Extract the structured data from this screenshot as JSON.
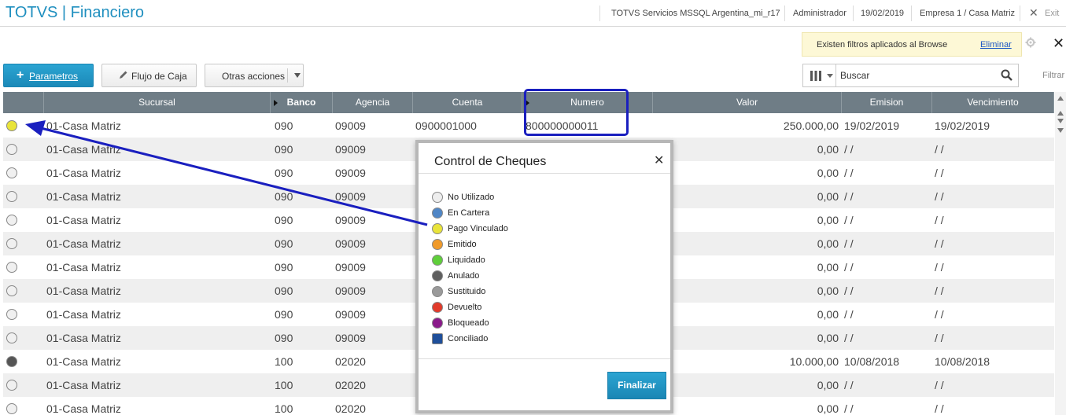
{
  "header": {
    "app_title": "TOTVS | Financiero",
    "environment": "TOTVS Servicios MSSQL Argentina_mi_r17",
    "user": "Administrador",
    "date": "19/02/2019",
    "company": "Empresa 1 / Casa Matriz",
    "exit_label": "Exit"
  },
  "filter_banner": {
    "message": "Existen filtros aplicados al Browse",
    "remove_link": "Eliminar"
  },
  "toolbar": {
    "parametros_label": "Parametros",
    "flujo_label": "Flujo de Caja",
    "otras_label": "Otras acciones"
  },
  "search": {
    "placeholder": "Buscar",
    "filter_label": "Filtrar"
  },
  "grid": {
    "columns": [
      "",
      "Sucursal",
      "Banco",
      "Agencia",
      "Cuenta",
      "Numero",
      "Valor",
      "Emision",
      "Vencimiento"
    ],
    "rows": [
      {
        "status": "yellow",
        "sucursal": "01-Casa Matriz",
        "banco": "090",
        "agencia": "09009",
        "cuenta": "0900001000",
        "numero": "800000000011",
        "valor": "250.000,00",
        "emision": "19/02/2019",
        "vencimiento": "19/02/2019"
      },
      {
        "status": "white",
        "sucursal": "01-Casa Matriz",
        "banco": "090",
        "agencia": "09009",
        "cuenta": "",
        "numero": "",
        "valor": "0,00",
        "emision": "/  /",
        "vencimiento": "/  /"
      },
      {
        "status": "white",
        "sucursal": "01-Casa Matriz",
        "banco": "090",
        "agencia": "09009",
        "cuenta": "",
        "numero": "",
        "valor": "0,00",
        "emision": "/  /",
        "vencimiento": "/  /"
      },
      {
        "status": "white",
        "sucursal": "01-Casa Matriz",
        "banco": "090",
        "agencia": "09009",
        "cuenta": "",
        "numero": "",
        "valor": "0,00",
        "emision": "/  /",
        "vencimiento": "/  /"
      },
      {
        "status": "white",
        "sucursal": "01-Casa Matriz",
        "banco": "090",
        "agencia": "09009",
        "cuenta": "",
        "numero": "",
        "valor": "0,00",
        "emision": "/  /",
        "vencimiento": "/  /"
      },
      {
        "status": "white",
        "sucursal": "01-Casa Matriz",
        "banco": "090",
        "agencia": "09009",
        "cuenta": "",
        "numero": "",
        "valor": "0,00",
        "emision": "/  /",
        "vencimiento": "/  /"
      },
      {
        "status": "white",
        "sucursal": "01-Casa Matriz",
        "banco": "090",
        "agencia": "09009",
        "cuenta": "",
        "numero": "",
        "valor": "0,00",
        "emision": "/  /",
        "vencimiento": "/  /"
      },
      {
        "status": "white",
        "sucursal": "01-Casa Matriz",
        "banco": "090",
        "agencia": "09009",
        "cuenta": "",
        "numero": "",
        "valor": "0,00",
        "emision": "/  /",
        "vencimiento": "/  /"
      },
      {
        "status": "white",
        "sucursal": "01-Casa Matriz",
        "banco": "090",
        "agencia": "09009",
        "cuenta": "",
        "numero": "",
        "valor": "0,00",
        "emision": "/  /",
        "vencimiento": "/  /"
      },
      {
        "status": "white",
        "sucursal": "01-Casa Matriz",
        "banco": "090",
        "agencia": "09009",
        "cuenta": "",
        "numero": "",
        "valor": "0,00",
        "emision": "/  /",
        "vencimiento": "/  /"
      },
      {
        "status": "darkgray",
        "sucursal": "01-Casa Matriz",
        "banco": "100",
        "agencia": "02020",
        "cuenta": "",
        "numero": "",
        "valor": "10.000,00",
        "emision": "10/08/2018",
        "vencimiento": "10/08/2018"
      },
      {
        "status": "white",
        "sucursal": "01-Casa Matriz",
        "banco": "100",
        "agencia": "02020",
        "cuenta": "",
        "numero": "",
        "valor": "0,00",
        "emision": "/  /",
        "vencimiento": "/  /"
      },
      {
        "status": "white",
        "sucursal": "01-Casa Matriz",
        "banco": "100",
        "agencia": "02020",
        "cuenta": "",
        "numero": "",
        "valor": "0,00",
        "emision": "/  /",
        "vencimiento": "/  /"
      }
    ]
  },
  "modal": {
    "title": "Control de Cheques",
    "legend": [
      {
        "label": "No Utilizado",
        "color": "#eeeeee",
        "icon": "circle"
      },
      {
        "label": "En Cartera",
        "color": "#4f86c6",
        "icon": "circle"
      },
      {
        "label": "Pago Vinculado",
        "color": "#e9e43a",
        "icon": "circle"
      },
      {
        "label": "Emitido",
        "color": "#f09a2a",
        "icon": "circle"
      },
      {
        "label": "Liquidado",
        "color": "#5fcf3a",
        "icon": "circle"
      },
      {
        "label": "Anulado",
        "color": "#5f5f5f",
        "icon": "circle"
      },
      {
        "label": "Sustituido",
        "color": "#9a9a9a",
        "icon": "circle"
      },
      {
        "label": "Devuelto",
        "color": "#e23a2a",
        "icon": "circle"
      },
      {
        "label": "Bloqueado",
        "color": "#8a1a8a",
        "icon": "circle"
      },
      {
        "label": "Conciliado",
        "color": "#1f4f9a",
        "icon": "square"
      }
    ],
    "finalize_label": "Finalizar"
  },
  "colors": {
    "accent": "#1f8fbf",
    "grid_header": "#6f7d86",
    "annotation": "#1a1fbf",
    "status_yellow": "#e9e43a",
    "status_white": "#f0f0f0",
    "status_darkgray": "#555555"
  }
}
